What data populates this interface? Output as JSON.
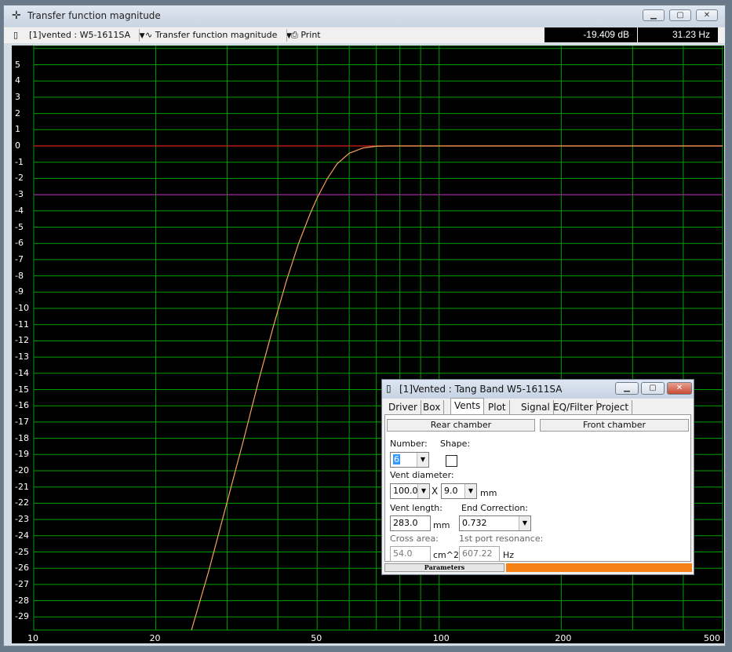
{
  "window": {
    "title": "Transfer function magnitude",
    "title_icon": "crosshair-icon"
  },
  "toolbar": {
    "project_selector": "[1]vented : W5-1611SA",
    "plot_selector": "Transfer function magnitude",
    "print_label": "Print",
    "readout_db": "-19.409 dB",
    "readout_hz": "31.23 Hz"
  },
  "colors": {
    "plot_bg": "#000000",
    "grid": "#00a000",
    "curve": "#f5a05a",
    "zero_line": "#d02020",
    "minus3_line": "#a020a0",
    "status_progress": "#f58216"
  },
  "chart_data": {
    "type": "line",
    "xscale": "log",
    "xlim": [
      10,
      500
    ],
    "ylim": [
      -30,
      6
    ],
    "xticks": [
      "10",
      "20",
      "50",
      "100",
      "200",
      "500"
    ],
    "yticks": [
      "5",
      "4",
      "3",
      "2",
      "1",
      "0",
      "-1",
      "-2",
      "-3",
      "-4",
      "-5",
      "-6",
      "-7",
      "-8",
      "-9",
      "-10",
      "-11",
      "-12",
      "-13",
      "-14",
      "-15",
      "-16",
      "-17",
      "-18",
      "-19",
      "-20",
      "-21",
      "-22",
      "-23",
      "-24",
      "-25",
      "-26",
      "-27",
      "-28",
      "-29"
    ],
    "grid": true,
    "reference_lines": [
      0,
      -3
    ],
    "series": [
      {
        "x": [
          24.5,
          27,
          30,
          33,
          36,
          39,
          42,
          45,
          48,
          50,
          53,
          56,
          60,
          65,
          70,
          75,
          80,
          100,
          150,
          200,
          300,
          500
        ],
        "y": [
          -30,
          -26.2,
          -21.9,
          -18.0,
          -14.3,
          -11.1,
          -8.3,
          -6.0,
          -4.2,
          -3.2,
          -2.0,
          -1.1,
          -0.45,
          -0.12,
          -0.02,
          0.0,
          0.0,
          0.0,
          0.0,
          0.0,
          0.0,
          0.0
        ]
      }
    ]
  },
  "dialog": {
    "title": "[1]Vented : Tang Band W5-1611SA",
    "tabs": [
      "Driver",
      "Box",
      "Vents",
      "Plot",
      "Signal",
      "EQ/Filter",
      "Project"
    ],
    "active_tab": "Vents",
    "rear_chamber": "Rear chamber",
    "front_chamber": "Front chamber",
    "number_label": "Number:",
    "number_value": "6",
    "shape_label": "Shape:",
    "vent_diameter_label": "Vent diameter:",
    "vent_diameter_a": "100.0",
    "vent_diameter_x": "X",
    "vent_diameter_b": "9.0",
    "diameter_unit": "mm",
    "vent_length_label": "Vent length:",
    "vent_length_value": "283.0",
    "length_unit": "mm",
    "end_correction_label": "End Correction:",
    "end_correction_value": "0.732",
    "cross_area_label": "Cross area:",
    "cross_area_value": "54.0",
    "cross_area_unit": "cm^2",
    "port_resonance_label": "1st port resonance:",
    "port_resonance_value": "607.22",
    "port_resonance_unit": "Hz",
    "status_label": "Parameters",
    "status_progress": 0.6
  }
}
